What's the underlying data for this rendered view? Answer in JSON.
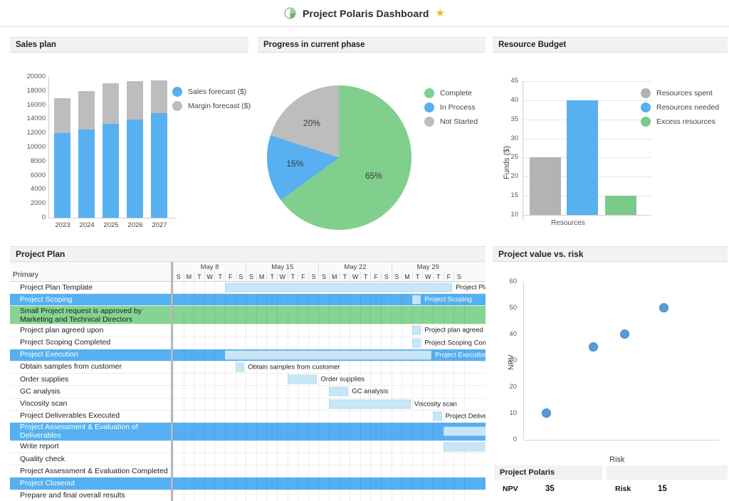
{
  "header": {
    "title": "Project Polaris Dashboard",
    "icon": "pie-chart-icon",
    "star": "★"
  },
  "panels": {
    "sales": "Sales plan",
    "progress": "Progress in current phase",
    "budget": "Resource Budget",
    "plan": "Project Plan",
    "risk": "Project value vs. risk"
  },
  "chart_data": [
    {
      "type": "bar",
      "title": "Sales plan",
      "stacked": true,
      "categories": [
        "2023",
        "2024",
        "2025",
        "2026",
        "2027"
      ],
      "series": [
        {
          "name": "Sales forecast ($)",
          "color": "#58b0f0",
          "values": [
            12000,
            12500,
            13300,
            13900,
            14800
          ]
        },
        {
          "name": "Margin forecast ($)",
          "color": "#bdbdbd",
          "values": [
            5000,
            5500,
            5800,
            5500,
            4700
          ]
        }
      ],
      "totals": [
        17000,
        18000,
        19100,
        19400,
        19500
      ],
      "ylim": [
        0,
        20000
      ],
      "yticks": [
        0,
        2000,
        4000,
        6000,
        8000,
        10000,
        12000,
        14000,
        16000,
        18000,
        20000
      ],
      "xlabel": "",
      "ylabel": "",
      "grid": false,
      "legend_position": "right"
    },
    {
      "type": "pie",
      "title": "Progress in current phase",
      "labels": [
        "Complete",
        "In Process",
        "Not Started"
      ],
      "values": [
        65,
        15,
        20
      ],
      "value_labels": [
        "65%",
        "15%",
        "20%"
      ],
      "colors": [
        "#80cf8d",
        "#58b0f0",
        "#bdbdbd"
      ],
      "legend_position": "right"
    },
    {
      "type": "bar",
      "title": "Resource Budget",
      "categories": [
        "Resources"
      ],
      "series": [
        {
          "name": "Resources spent",
          "color": "#b3b3b3",
          "values": [
            25
          ]
        },
        {
          "name": "Resources needed",
          "color": "#58b0f0",
          "values": [
            40
          ]
        },
        {
          "name": "Excess resources",
          "color": "#7cca89",
          "values": [
            15
          ]
        }
      ],
      "ylim": [
        10,
        45
      ],
      "yticks": [
        10,
        15,
        20,
        25,
        30,
        35,
        40,
        45
      ],
      "xlabel": "",
      "ylabel": "Funds ($)",
      "xtick_labels": [
        "Resources"
      ],
      "grid": true,
      "legend_position": "right"
    },
    {
      "type": "scatter",
      "title": "Project value vs. risk",
      "xlabel": "Risk",
      "ylabel": "NPV",
      "ylim": [
        0,
        60
      ],
      "yticks": [
        0,
        10,
        20,
        30,
        40,
        50,
        60
      ],
      "points": [
        {
          "x": 12,
          "y": 10
        },
        {
          "x": 36,
          "y": 35
        },
        {
          "x": 52,
          "y": 40
        },
        {
          "x": 72,
          "y": 50
        }
      ],
      "color": "#5b9bd5",
      "grid": false,
      "legend_position": "none"
    }
  ],
  "gantt": {
    "primary_header": "Primary",
    "weeks": [
      "May 8",
      "May 15",
      "May 22",
      "May 29"
    ],
    "days": [
      "S",
      "M",
      "T",
      "W",
      "T",
      "F",
      "S"
    ],
    "tasks": [
      {
        "name": "Project Plan Template",
        "style": "normal",
        "bar_start": 5,
        "bar_len": 22,
        "label": "Project Plan Template"
      },
      {
        "name": "Project Scoping",
        "style": "summary",
        "bar_start": 23,
        "bar_len": 1,
        "label": "Project Scoping"
      },
      {
        "name": "Small Project request is approved by Marketing and Technical Directors",
        "style": "green",
        "bar_start": -1,
        "bar_len": 0,
        "label": ""
      },
      {
        "name": "Project plan agreed upon",
        "style": "normal",
        "bar_start": 23,
        "bar_len": 1,
        "label": "Project plan agreed upon"
      },
      {
        "name": "Project Scoping Completed",
        "style": "normal",
        "bar_start": 23,
        "bar_len": 1,
        "label": "Project Scoping Completed"
      },
      {
        "name": "Project Execution",
        "style": "summary",
        "bar_start": 5,
        "bar_len": 20,
        "label": "Project Execution"
      },
      {
        "name": "Obtain samples from customer",
        "style": "normal",
        "bar_start": 6,
        "bar_len": 1,
        "label": "Obtain samples from customer"
      },
      {
        "name": "Order supplies",
        "style": "normal",
        "bar_start": 11,
        "bar_len": 3,
        "label": "Order supplies"
      },
      {
        "name": "GC analysis",
        "style": "normal",
        "bar_start": 15,
        "bar_len": 2,
        "label": "GC analysis"
      },
      {
        "name": "Viscosity scan",
        "style": "normal",
        "bar_start": 15,
        "bar_len": 8,
        "label": "Viscosity scan"
      },
      {
        "name": "Project Deliverables Executed",
        "style": "normal",
        "bar_start": 25,
        "bar_len": 1,
        "label": "Project Deliverables Executed"
      },
      {
        "name": "Project Assessment & Evaluation of Deliverables",
        "style": "summary",
        "bar_start": 26,
        "bar_len": 9,
        "label": "Project Assessment & Evaluation of Deliverables"
      },
      {
        "name": "Write report",
        "style": "normal",
        "bar_start": 26,
        "bar_len": 6,
        "label": "Write report"
      },
      {
        "name": "Quality check",
        "style": "normal",
        "bar_start": 33,
        "bar_len": 1,
        "label": "Quality check"
      },
      {
        "name": "Project Assessment & Evaluation Completed",
        "style": "normal",
        "bar_start": 35,
        "bar_len": 1,
        "label": "Project Assessment & Evaluation Completed"
      },
      {
        "name": "Project Closeout",
        "style": "summary",
        "bar_start": -1,
        "bar_len": 0,
        "label": ""
      },
      {
        "name": "Prepare and final overall results",
        "style": "normal",
        "bar_start": -1,
        "bar_len": 0,
        "label": ""
      }
    ]
  },
  "kpi": {
    "left_title": "Project Polaris",
    "right_title": "",
    "npv_label": "NPV",
    "npv_value": "35",
    "risk_label": "Risk",
    "risk_value": "15"
  },
  "colors": {
    "blue": "#58b0f0",
    "gray": "#bdbdbd",
    "green": "#80cf8d",
    "bar_fill": "#c9e6f7",
    "summary_row": "#55b0f3",
    "green_row": "#85d492"
  }
}
